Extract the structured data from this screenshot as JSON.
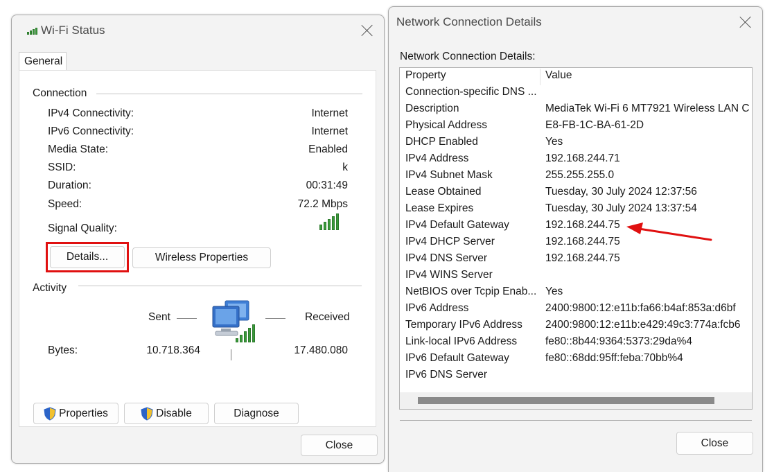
{
  "wifi_status": {
    "title": "Wi-Fi Status",
    "tab": "General",
    "connection_header": "Connection",
    "rows": [
      {
        "label": "IPv4 Connectivity:",
        "value": "Internet"
      },
      {
        "label": "IPv6 Connectivity:",
        "value": "Internet"
      },
      {
        "label": "Media State:",
        "value": "Enabled"
      },
      {
        "label": "SSID:",
        "value": "k"
      },
      {
        "label": "Duration:",
        "value": "00:31:49"
      },
      {
        "label": "Speed:",
        "value": "72.2 Mbps"
      }
    ],
    "signal_label": "Signal Quality:",
    "details_button": "Details...",
    "wireless_properties_button": "Wireless Properties",
    "activity_header": "Activity",
    "sent_label": "Sent",
    "received_label": "Received",
    "bytes_label": "Bytes:",
    "bytes_sent": "10.718.364",
    "bytes_received": "17.480.080",
    "properties_button": "Properties",
    "disable_button": "Disable",
    "diagnose_button": "Diagnose",
    "close_button": "Close"
  },
  "details": {
    "title": "Network Connection Details",
    "caption": "Network Connection Details:",
    "col_property": "Property",
    "col_value": "Value",
    "rows": [
      {
        "p": "Connection-specific DNS ...",
        "v": ""
      },
      {
        "p": "Description",
        "v": "MediaTek Wi-Fi 6 MT7921 Wireless LAN C"
      },
      {
        "p": "Physical Address",
        "v": "E8-FB-1C-BA-61-2D"
      },
      {
        "p": "DHCP Enabled",
        "v": "Yes"
      },
      {
        "p": "IPv4 Address",
        "v": "192.168.244.71"
      },
      {
        "p": "IPv4 Subnet Mask",
        "v": "255.255.255.0"
      },
      {
        "p": "Lease Obtained",
        "v": "Tuesday, 30 July 2024 12:37:56"
      },
      {
        "p": "Lease Expires",
        "v": "Tuesday, 30 July 2024 13:37:54"
      },
      {
        "p": "IPv4 Default Gateway",
        "v": "192.168.244.75"
      },
      {
        "p": "IPv4 DHCP Server",
        "v": "192.168.244.75"
      },
      {
        "p": "IPv4 DNS Server",
        "v": "192.168.244.75"
      },
      {
        "p": "IPv4 WINS Server",
        "v": ""
      },
      {
        "p": "NetBIOS over Tcpip Enab...",
        "v": "Yes"
      },
      {
        "p": "IPv6 Address",
        "v": "2400:9800:12:e11b:fa66:b4af:853a:d6bf"
      },
      {
        "p": "Temporary IPv6 Address",
        "v": "2400:9800:12:e11b:e429:49c3:774a:fcb6"
      },
      {
        "p": "Link-local IPv6 Address",
        "v": "fe80::8b44:9364:5373:29da%4"
      },
      {
        "p": "IPv6 Default Gateway",
        "v": "fe80::68dd:95ff:feba:70bb%4"
      },
      {
        "p": "IPv6 DNS Server",
        "v": ""
      }
    ],
    "close_button": "Close"
  },
  "colors": {
    "highlight_box": "#e01010",
    "arrow": "#e01010",
    "signal_green": "#3a9a3a"
  }
}
